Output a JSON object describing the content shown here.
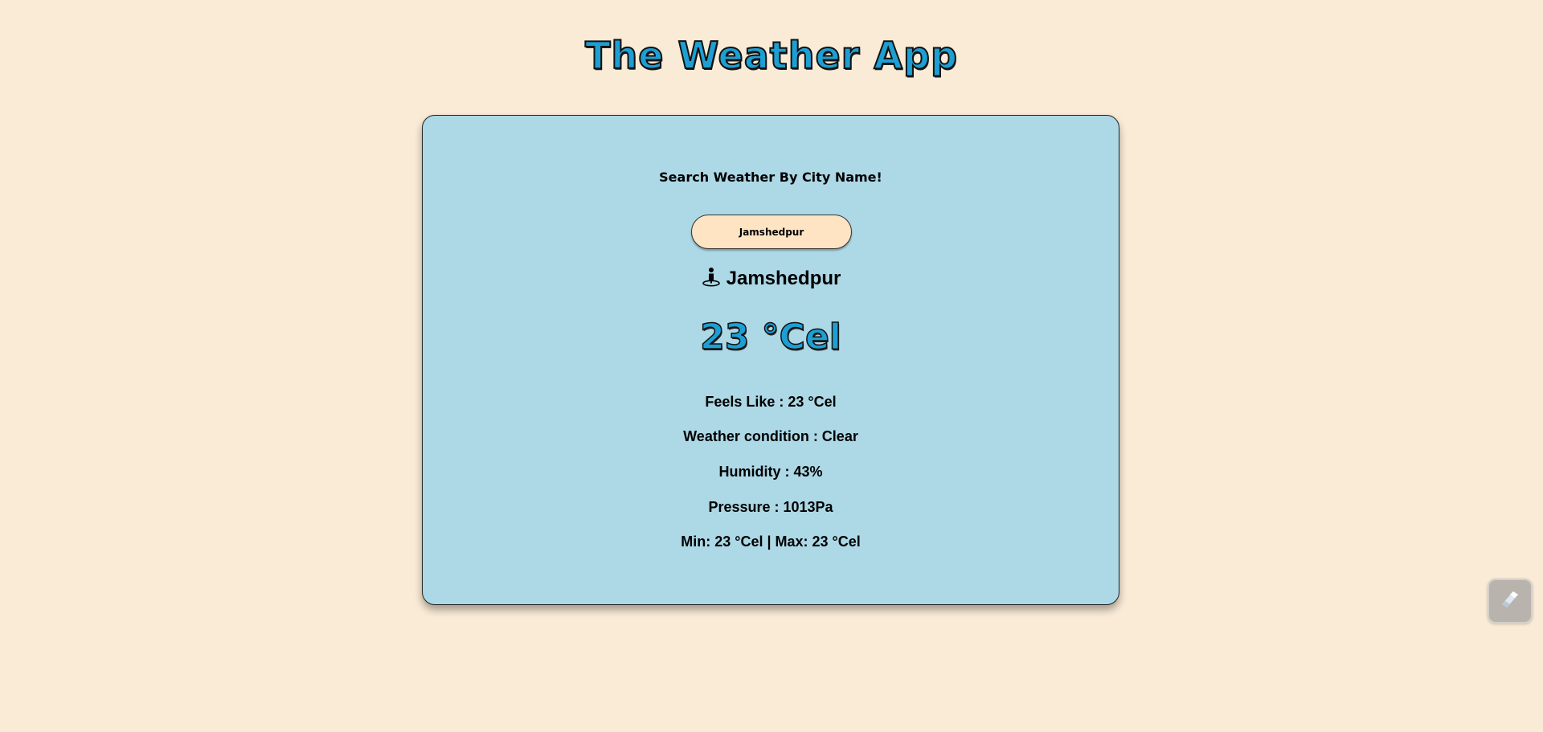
{
  "app": {
    "title": "The Weather App"
  },
  "search": {
    "heading": "Search Weather By City Name!",
    "value": "Jamshedpur"
  },
  "location": {
    "icon": "person-pin-icon",
    "city": "Jamshedpur"
  },
  "weather": {
    "temperature": "23 °Cel",
    "feels_like": "Feels Like : 23 °Cel",
    "condition": "Weather condition : Clear",
    "humidity": "Humidity : 43%",
    "pressure": "Pressure : 1013Pa",
    "min_max": "Min: 23 °Cel | Max: 23 °Cel"
  },
  "floating_button": {
    "icon": "extension-logo-icon"
  },
  "colors": {
    "page_background": "#faebd7",
    "card_background": "#add8e6",
    "accent": "#1e9fd3",
    "input_background": "#ffe4c4"
  }
}
